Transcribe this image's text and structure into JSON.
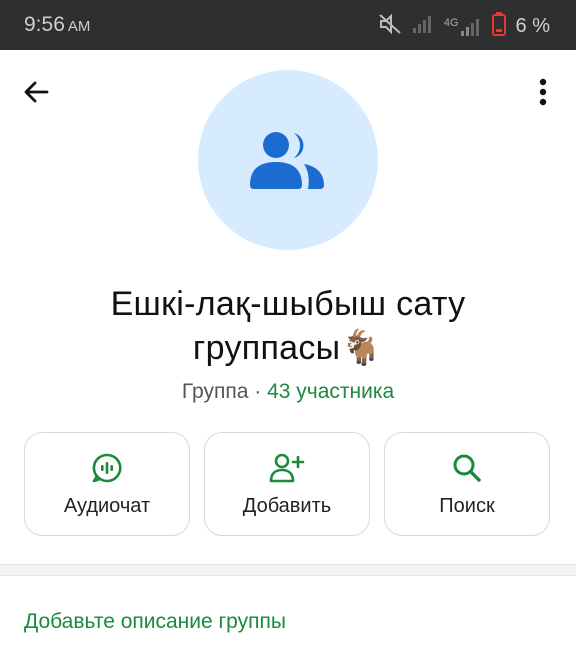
{
  "status_bar": {
    "time": "9:56",
    "ampm": "AM",
    "network": "4G",
    "battery_percent": "6 %",
    "icons": [
      "mute-icon",
      "signal-icon",
      "signal-icon",
      "battery-low-icon"
    ]
  },
  "header": {
    "back_icon": "arrow-left-icon",
    "menu_icon": "more-vertical-icon"
  },
  "group": {
    "avatar_icon": "group-icon",
    "avatar_bg": "#d6ebfd",
    "avatar_fg": "#1a6cd1",
    "name": "Ешкі-лақ-шыбыш сату группасы🐐",
    "type": "Группа",
    "separator": " · ",
    "members": "43 участника"
  },
  "actions": [
    {
      "label": "Аудиочат",
      "icon": "audio-chat-icon"
    },
    {
      "label": "Добавить",
      "icon": "add-person-icon"
    },
    {
      "label": "Поиск",
      "icon": "search-icon"
    }
  ],
  "description": {
    "add_label": "Добавьте описание группы"
  },
  "colors": {
    "accent": "#1a8a3c",
    "status_bar": "#2f2f2f"
  }
}
